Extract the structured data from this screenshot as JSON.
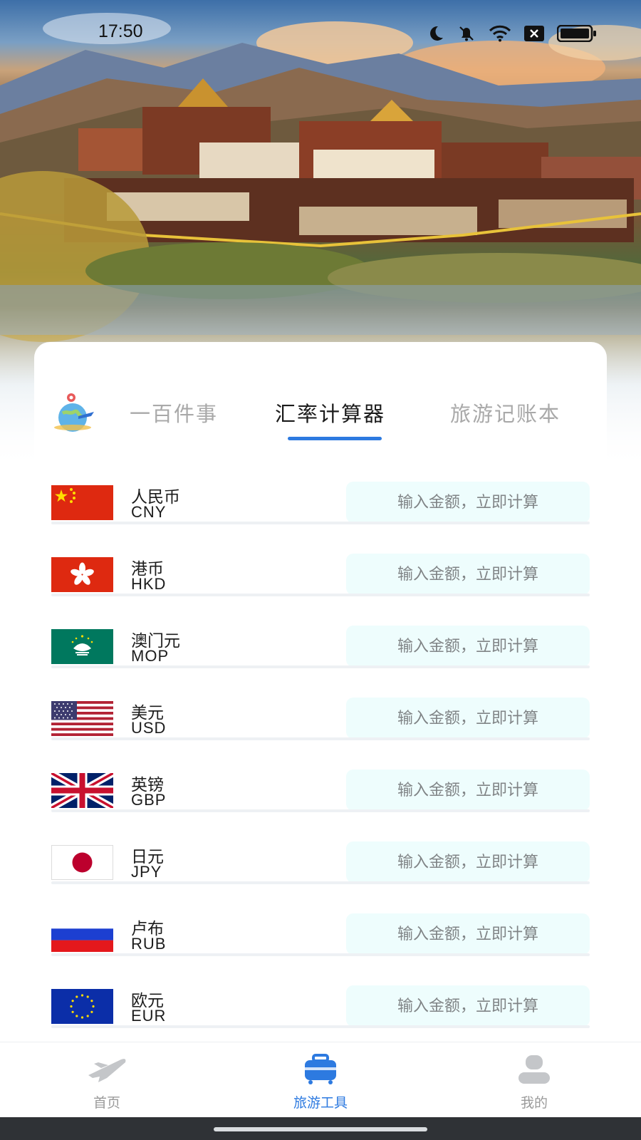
{
  "status_bar": {
    "time": "17:50",
    "icons": [
      "moon-icon",
      "bell-off-icon",
      "wifi-icon",
      "sim-off-icon",
      "battery-icon"
    ]
  },
  "tabs": [
    {
      "label": "一百件事",
      "active": false
    },
    {
      "label": "汇率计算器",
      "active": true
    },
    {
      "label": "旅游记账本",
      "active": false
    }
  ],
  "accent_color": "#2d7ae0",
  "input_background": "#eefdfd",
  "currencies": [
    {
      "name": "人民币",
      "code": "CNY",
      "flag": "china-flag-icon",
      "placeholder": "输入金额，立即计算"
    },
    {
      "name": "港币",
      "code": "HKD",
      "flag": "hong-kong-flag-icon",
      "placeholder": "输入金额，立即计算"
    },
    {
      "name": "澳门元",
      "code": "MOP",
      "flag": "macau-flag-icon",
      "placeholder": "输入金额，立即计算"
    },
    {
      "name": "美元",
      "code": "USD",
      "flag": "usa-flag-icon",
      "placeholder": "输入金额，立即计算"
    },
    {
      "name": "英镑",
      "code": "GBP",
      "flag": "uk-flag-icon",
      "placeholder": "输入金额，立即计算"
    },
    {
      "name": "日元",
      "code": "JPY",
      "flag": "japan-flag-icon",
      "placeholder": "输入金额，立即计算"
    },
    {
      "name": "卢布",
      "code": "RUB",
      "flag": "russia-flag-icon",
      "placeholder": "输入金额，立即计算"
    },
    {
      "name": "欧元",
      "code": "EUR",
      "flag": "eu-flag-icon",
      "placeholder": "输入金额，立即计算"
    }
  ],
  "bottom_nav": [
    {
      "label": "首页",
      "icon": "airplane-icon",
      "active": false
    },
    {
      "label": "旅游工具",
      "icon": "suitcase-icon",
      "active": true
    },
    {
      "label": "我的",
      "icon": "user-icon",
      "active": false
    }
  ]
}
